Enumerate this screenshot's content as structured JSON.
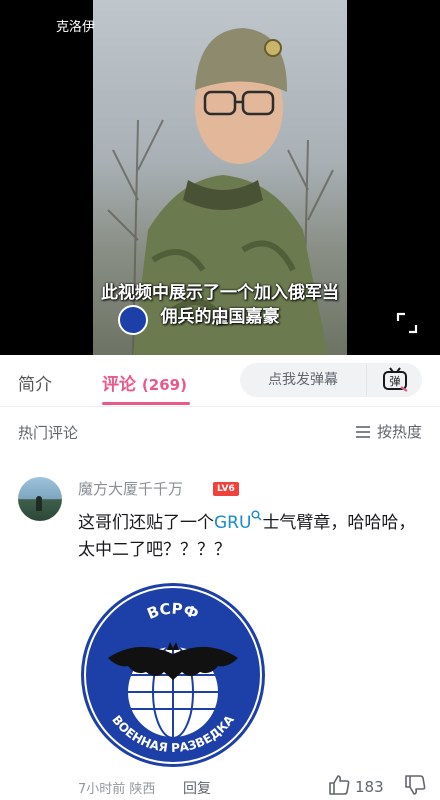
{
  "video": {
    "title": "克洛伊",
    "subtitle_line1": "此视频中展示了一个加入俄军当雇",
    "subtitle_line2": "佣兵的中国嘉豪"
  },
  "tabs": {
    "intro": "简介",
    "comments": "评论",
    "comments_count": "(269)",
    "danmaku_placeholder": "点我发弹幕",
    "danmaku_button": "弹"
  },
  "comments_header": {
    "title": "热门评论",
    "sort": "按热度"
  },
  "comment": {
    "username": "魔方大厦千千万",
    "level": "LV6",
    "text_before": "这哥们还贴了一个",
    "link": "GRU",
    "text_after": "士气臂章，哈哈哈，太中二了吧？？？？",
    "patch_top_text": "ВСРФ",
    "patch_bottom_text": "ВОЕННАЯ РАЗВЕДКА",
    "time": "7小时前",
    "location": "陕西",
    "reply": "回复",
    "likes": "183"
  },
  "colors": {
    "accent": "#e85a8a",
    "link": "#178bcf",
    "level_badge": "#f0413c",
    "patch_blue": "#1d3fa8"
  }
}
